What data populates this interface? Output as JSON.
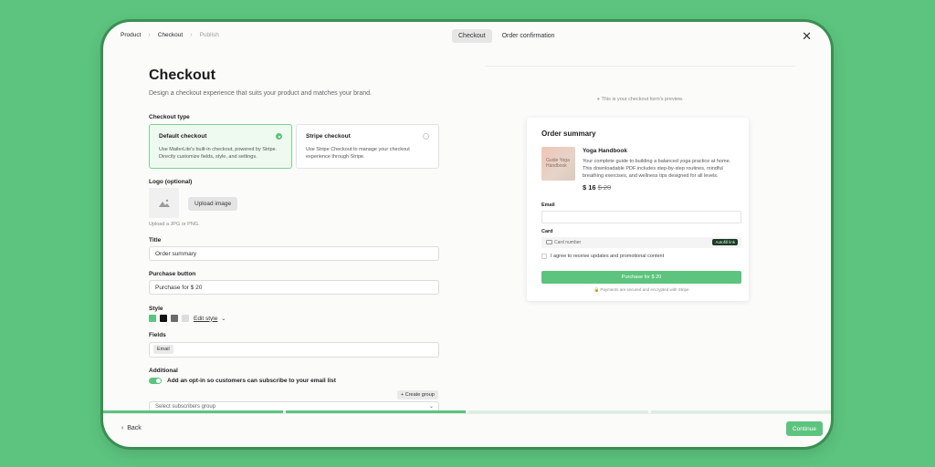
{
  "breadcrumb": {
    "items": [
      "Product",
      "Checkout",
      "Publish"
    ],
    "separator": "›"
  },
  "tabs": [
    "Checkout",
    "Order confirmation"
  ],
  "form": {
    "title": "Checkout",
    "subtitle": "Design a checkout experience that suits your product and matches your brand.",
    "checkout_type_label": "Checkout type",
    "options": [
      {
        "title": "Default checkout",
        "desc": "Use MailerLite's built-in checkout, powered by Stripe. Directly customize fields, style, and settings.",
        "selected": true
      },
      {
        "title": "Stripe checkout",
        "desc": "Use Stripe Checkout to manage your checkout experience through Stripe.",
        "selected": false
      }
    ],
    "logo_label": "Logo (optional)",
    "upload_label": "Upload image",
    "upload_hint": "Upload a JPG or PNG.",
    "title_label": "Title",
    "title_value": "Order summary",
    "purchase_label": "Purchase button",
    "purchase_value": "Purchase for $ 20",
    "style_label": "Style",
    "swatches": [
      "#5cc47e",
      "#111111",
      "#6b6b6b",
      "#dddddd"
    ],
    "edit_style": "Edit style",
    "fields_label": "Fields",
    "fields_chip": "Email",
    "additional_label": "Additional",
    "optin_text": "Add an opt-in so customers can subscribe to your email list",
    "create_group": "+ Create group",
    "select_placeholder": "Select subscribers group"
  },
  "footer": {
    "back": "Back",
    "continue": "Continue"
  },
  "progress": {
    "steps": 4,
    "completed": 2
  },
  "preview": {
    "note": "This is your checkout form's preview.",
    "summary_title": "Order summary",
    "book_cover": "Guide Yoga Handbook",
    "product_name": "Yoga Handbook",
    "product_desc": "Your complete guide to building a balanced yoga practice at home. This downloadable PDF includes step-by-step routines, mindful breathing exercises, and wellness tips designed for all levels.",
    "price": "$ 16",
    "old_price": "$ 20",
    "email_label": "Email",
    "card_label": "Card",
    "card_placeholder": "Card number",
    "autofill": "Autofill link",
    "agree": "I agree to receive updates and promotional content",
    "purchase": "Purchase for $ 20",
    "secure": "Payments are secured and encrypted with Stripe"
  },
  "colors": {
    "accent": "#5cc47e",
    "background": "#5cc47e"
  }
}
